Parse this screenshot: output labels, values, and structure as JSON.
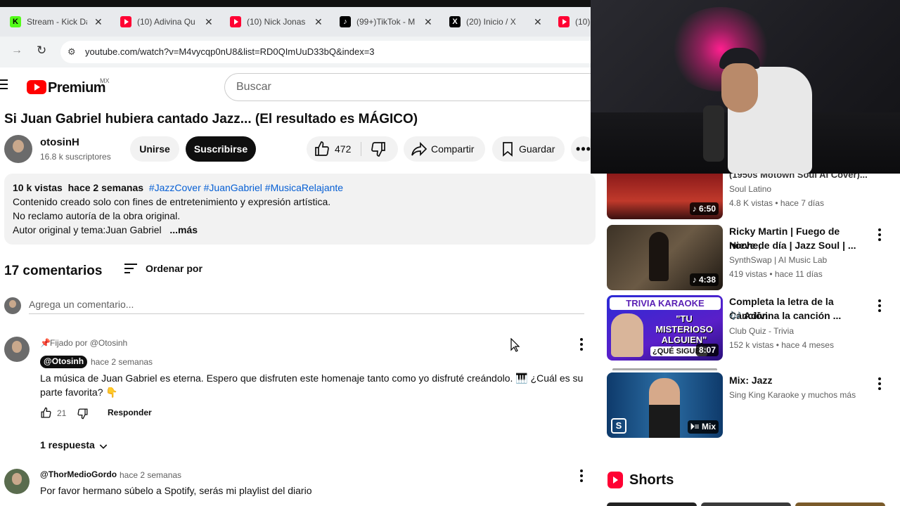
{
  "browser": {
    "tabs": [
      {
        "title": "Stream - Kick Da",
        "icon": "kick-icon"
      },
      {
        "title": "(10) Adivina Qu",
        "icon": "youtube-icon"
      },
      {
        "title": "(10) Nick Jonas",
        "icon": "youtube-icon"
      },
      {
        "title": "(99+)TikTok - M",
        "icon": "tiktok-icon"
      },
      {
        "title": "(20) Inicio / X",
        "icon": "x-icon"
      },
      {
        "title": "(10)",
        "icon": "youtube-icon"
      }
    ],
    "url": "youtube.com/watch?v=M4vycqp0nU8&list=RD0QImUuD33bQ&index=3"
  },
  "header": {
    "brand": "Premium",
    "region": "MX",
    "search_placeholder": "Buscar"
  },
  "video": {
    "title": "Si Juan Gabriel hubiera cantado Jazz... (El resultado es MÁGICO)",
    "channel": "otosinH",
    "subscribers": "16.8 k suscriptores",
    "join_label": "Unirse",
    "subscribe_label": "Suscribirse",
    "likes": "472",
    "share_label": "Compartir",
    "save_label": "Guardar"
  },
  "description": {
    "views": "10 k vistas",
    "age": "hace 2 semanas",
    "hashtags": "#JazzCover #JuanGabriel #MusicaRelajante",
    "line1": "Contenido creado solo con fines de entretenimiento y expresión artística.",
    "line2": "No reclamo autoría de la obra original.",
    "line3": "Autor original y tema:Juan Gabriel",
    "more": "...más"
  },
  "comments": {
    "count_label": "17 comentarios",
    "sort_label": "Ordenar por",
    "add_placeholder": "Agrega un comentario...",
    "items": [
      {
        "pinned": "Fijado por @Otosinh",
        "author": "@Otosinh",
        "time": "hace 2 semanas",
        "text1": "La música de Juan Gabriel es eterna. Espero que disfruten este homenaje tanto como yo disfruté creándolo. 🎹 ¿Cuál es su",
        "text2": "parte favorita? 👇",
        "likes": "21",
        "reply_label": "Responder",
        "replies_label": "1 respuesta"
      },
      {
        "author": "@ThorMedioGordo",
        "time": "hace 2 semanas",
        "text1": "Por favor hermano súbelo a Spotify, serás mi playlist del diario"
      }
    ]
  },
  "sidebar": {
    "items": [
      {
        "title1": "(1950s Motown Soul AI Cover)...",
        "channel": "Soul Latino",
        "meta": "4.8 K vistas • hace 7 días",
        "duration": "6:50"
      },
      {
        "title1": "Ricky Martin | Fuego de noche,",
        "title2": "Nieve de día | Jazz Soul | ...",
        "channel": "SynthSwap | AI Music Lab",
        "meta": "419 vistas • hace 11 días",
        "duration": "4:38"
      },
      {
        "title1": "Completa la letra de la Canción",
        "title2": "🎶 Adivina la canción ...",
        "channel": "Club Quiz - Trivia",
        "meta": "152 k vistas • hace 4 meses",
        "duration": "8:07",
        "thumb_text1": "TRIVIA KARAOKE",
        "thumb_text2": "\"TU MISTERIOSO ALGUIEN\"",
        "thumb_text3": "¿QUÉ SIGUE?"
      },
      {
        "title1": "Mix: Jazz",
        "channel": "Sing King Karaoke y muchos más",
        "badge": "Mix"
      }
    ],
    "shorts_label": "Shorts"
  },
  "colors": {
    "youtube_red": "#ff0033",
    "link_blue": "#065fd4",
    "chip_gray": "#f2f2f2"
  }
}
